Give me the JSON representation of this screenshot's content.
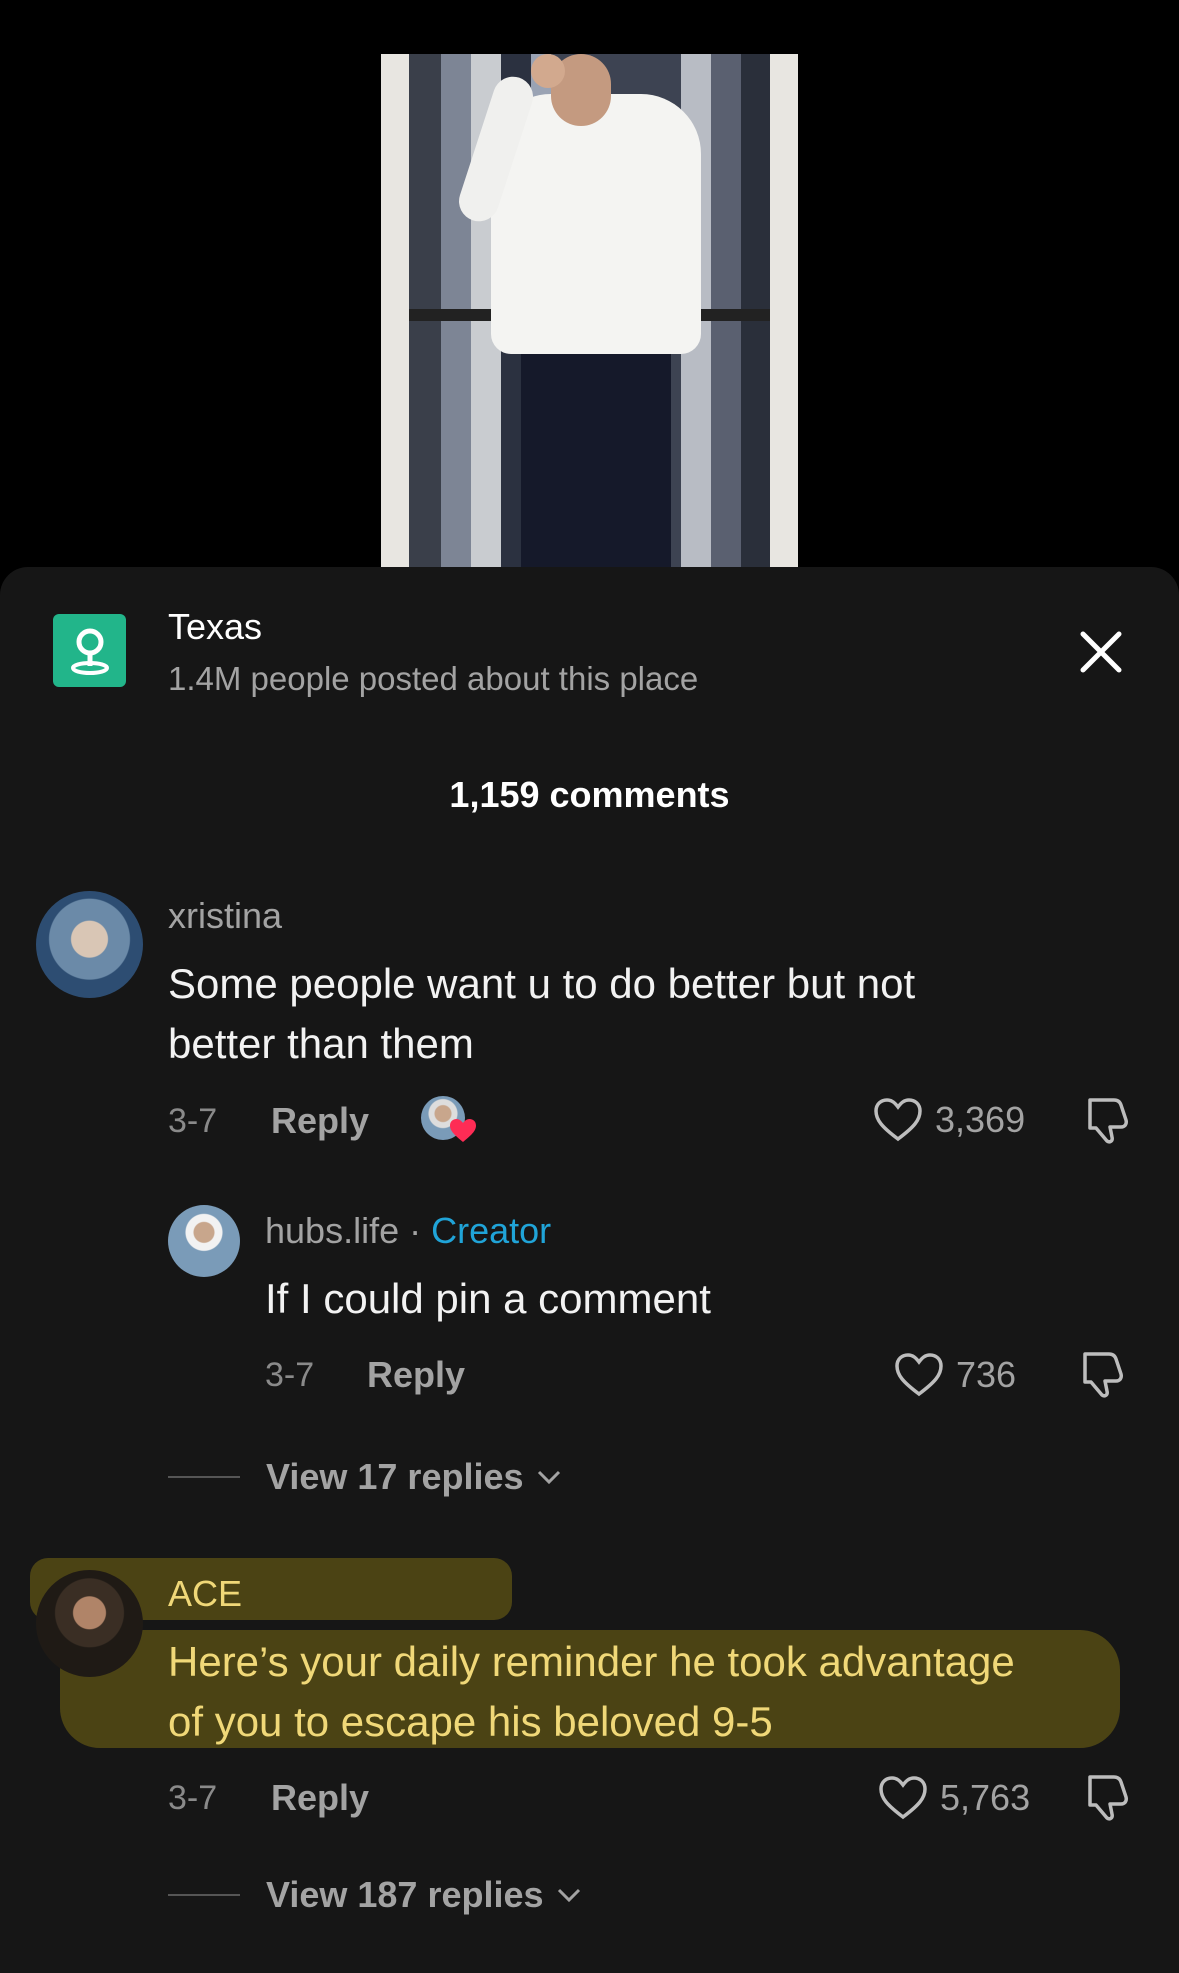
{
  "location": {
    "title": "Texas",
    "subtitle": "1.4M people posted about this place"
  },
  "comments_header": "1,159 comments",
  "comments": [
    {
      "user": "xristina",
      "text_line1": "Some people want u to do better but not",
      "text_line2": "better than them",
      "date": "3-7",
      "reply_label": "Reply",
      "likes": "3,369",
      "liked_by_creator": true
    },
    {
      "user": "ACE",
      "text_line1": "Here’s your daily reminder he took advantage",
      "text_line2": "of you to escape his beloved 9-5",
      "date": "3-7",
      "reply_label": "Reply",
      "likes": "5,763",
      "view_replies": "View 187 replies"
    }
  ],
  "reply": {
    "user": "hubs.life",
    "separator": "·",
    "badge": "Creator",
    "text": "If I could pin a comment",
    "date": "3-7",
    "reply_label": "Reply",
    "likes": "736",
    "view_replies": "View 17 replies"
  },
  "colors": {
    "sheet_bg": "#161616",
    "creator_badge": "#20a4d8",
    "highlight": "#f0d878",
    "location_icon_bg": "#22b58a",
    "heart_badge": "#fe2c55"
  }
}
